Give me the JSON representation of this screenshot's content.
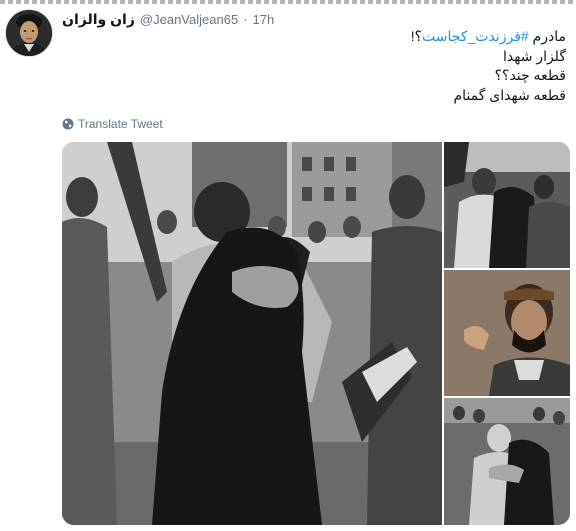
{
  "tweet": {
    "display_name": "زان والزان",
    "handle": "@JeanValjean65",
    "separator": "·",
    "time": "17h",
    "text": {
      "line1_prefix": "مادرم ",
      "hashtag": "#فرزندت_کجاست",
      "line1_suffix": "؟!",
      "line2": "گلزار شهدا",
      "line3": "قطعه چند؟؟",
      "line4": "قطعه شهدای گمنام"
    },
    "translate_label": "Translate Tweet"
  },
  "icons": {
    "translate": "globe-icon",
    "avatar": "avatar-portrait"
  },
  "colors": {
    "name": "#14171a",
    "muted": "#657786",
    "link": "#1b95e0"
  }
}
